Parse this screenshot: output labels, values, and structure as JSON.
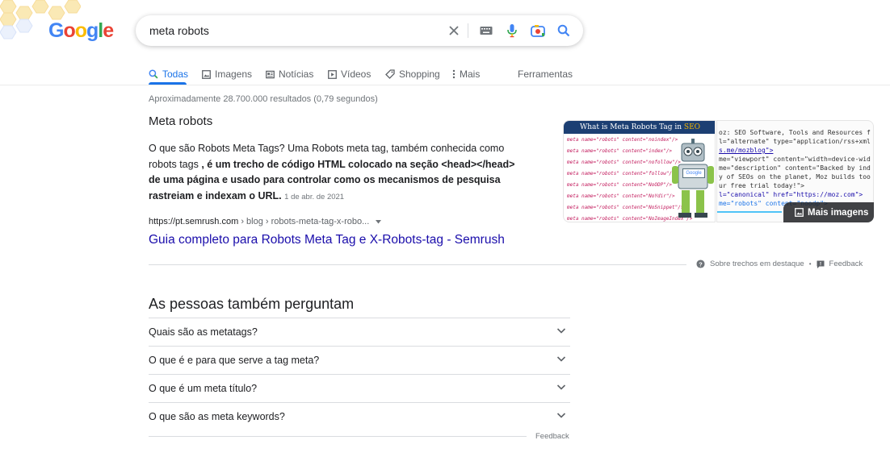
{
  "search": {
    "query": "meta robots"
  },
  "tabs": [
    {
      "label": "Todas",
      "icon": "search-icon"
    },
    {
      "label": "Imagens",
      "icon": "image-icon"
    },
    {
      "label": "Notícias",
      "icon": "news-icon"
    },
    {
      "label": "Vídeos",
      "icon": "video-icon"
    },
    {
      "label": "Shopping",
      "icon": "tag-icon"
    },
    {
      "label": "Mais",
      "icon": "more-vert-icon"
    },
    {
      "label": "Ferramentas"
    }
  ],
  "stats": "Aproximadamente 28.700.000 resultados (0,79 segundos)",
  "featured": {
    "title": "Meta robots",
    "body_1": "O que são Robots Meta Tags? Uma Robots meta tag, também conhecida como robots tags ",
    "body_bold": ", é um trecho de código HTML colocado na seção <head></head> de uma página e usado para controlar como os mecanismos de pesquisa rastreiam e indexam o URL.",
    "date": "1 de abr. de 2021",
    "cite_domain": "https://pt.semrush.com",
    "cite_path": " › blog › robots-meta-tag-x-robo...",
    "link_title": "Guia completo para Robots Meta Tag e X-Robots-tag - Semrush",
    "image1_title_a": "What is Meta Robots Tag in ",
    "image1_title_b": "SEO",
    "image1_lines": [
      "meta name=\"robots\" content=\"noindex\"/>",
      "meta name=\"robots\" content=\"index\"/>",
      "meta name=\"robots\" content=\"nofollow\"/>",
      "meta name=\"robots\" content=\"follow\"/>",
      "meta name=\"robots\" content=\"NoODP\"/>",
      "meta name=\"robots\" content=\"NoYdir\"/>",
      "meta name=\"robots\" content=\"NoSnippet\"/>",
      "meta name=\"robots\" content=\"NoImageIndex\"/>"
    ],
    "image1_badge": "Google",
    "image2_lines": [
      "oz: SEO Software, Tools and Resources f",
      "l=\"alternate\" type=\"application/rss+xml",
      "s.me/mozblog\">",
      "me=\"viewport\" content=\"width=device-wid",
      "me=\"description\" content=\"Backed by ind",
      "y of SEOs on the planet, Moz builds too",
      "ur free trial today!\">",
      "l=\"canonical\" href=\"https://moz.com\">",
      "me=\"robots\" content=\"noodp\">"
    ],
    "more_images": "Mais imagens",
    "about": "Sobre trechos em destaque",
    "feedback": "Feedback"
  },
  "paa": {
    "title": "As pessoas também perguntam",
    "questions": [
      "Quais são as metatags?",
      "O que é e para que serve a tag meta?",
      "O que é um meta título?",
      "O que são as meta keywords?"
    ],
    "feedback": "Feedback"
  },
  "colors": {
    "accent": "#1a73e8",
    "link": "#1a0dab"
  }
}
